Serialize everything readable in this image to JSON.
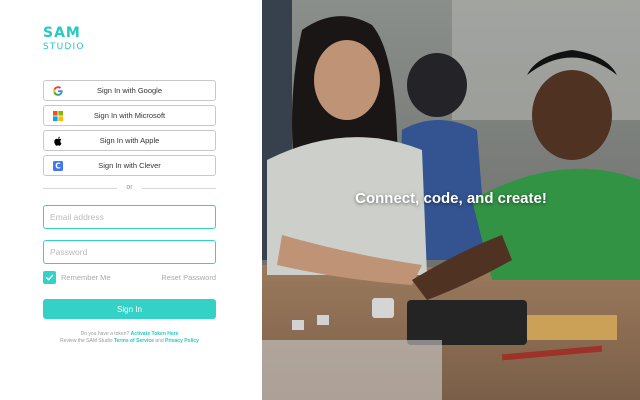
{
  "brand": {
    "logo_top": "SAM",
    "logo_bottom": "STUDIO",
    "accent": "#34d1c7"
  },
  "sso": [
    {
      "label": "Sign In with Google",
      "icon": "google-icon"
    },
    {
      "label": "Sign In with Microsoft",
      "icon": "microsoft-icon"
    },
    {
      "label": "Sign In with Apple",
      "icon": "apple-icon"
    },
    {
      "label": "Sign In with Clever",
      "icon": "clever-icon"
    }
  ],
  "divider": "or",
  "form": {
    "email_placeholder": "Email address",
    "password_placeholder": "Password",
    "remember_label": "Remember Me",
    "remember_checked": true,
    "reset_label": "Reset Password",
    "signin_label": "Sign In"
  },
  "footer": {
    "line1_text": "Do you have a token?",
    "line1_link": "Activate Token Here",
    "line2_text": "Review the SAM Studio",
    "line2_link1": "Terms of Service",
    "line2_and": "and",
    "line2_link2": "Privacy Policy"
  },
  "hero": {
    "tagline": "Connect, code, and create!"
  }
}
